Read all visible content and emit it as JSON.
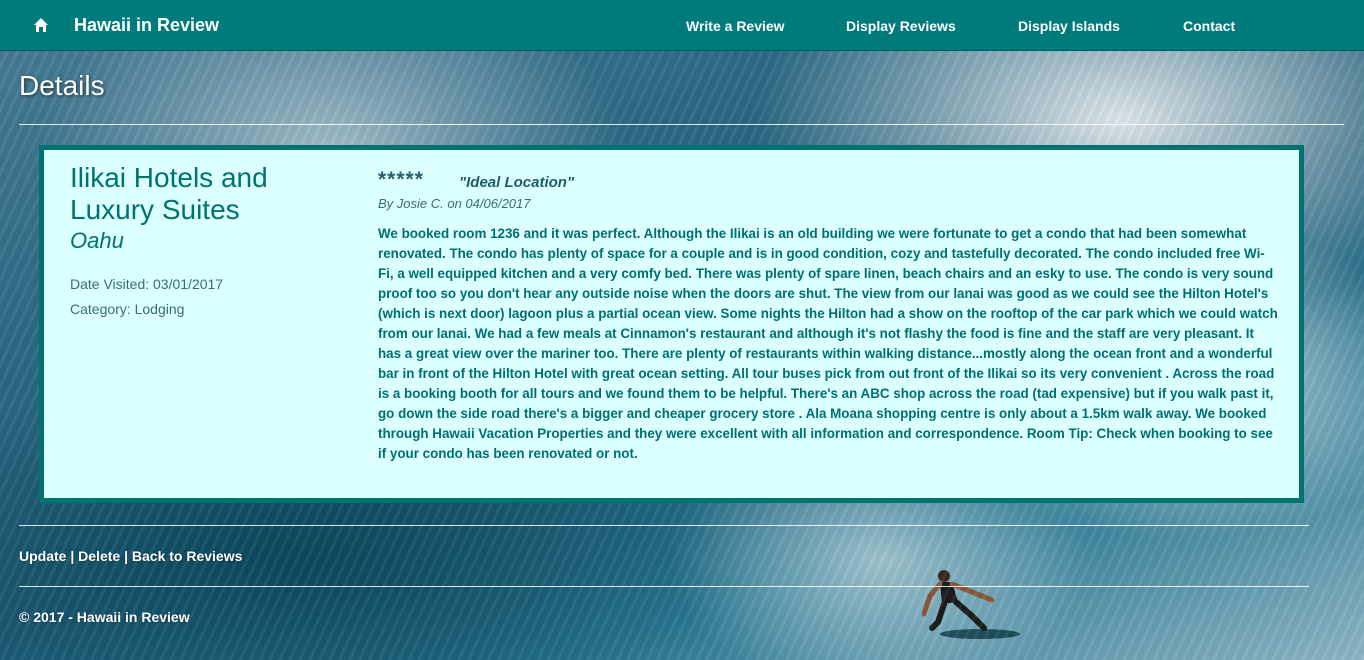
{
  "nav": {
    "home_icon": "home-icon",
    "brand": "Hawaii in Review",
    "links": [
      "Write a Review",
      "Display Reviews",
      "Display Islands",
      "Contact"
    ]
  },
  "page_title": "Details",
  "place": {
    "name": "Ilikai Hotels and Luxury Suites",
    "island": "Oahu",
    "date_visited_label": "Date Visited:",
    "date_visited": "03/01/2017",
    "category_label": "Category:",
    "category": "Lodging"
  },
  "review": {
    "rating": 5,
    "stars": "*****",
    "title": "\"Ideal Location\"",
    "byline": "By Josie C. on 04/06/2017",
    "body": "We booked room 1236 and it was perfect. Although the Ilikai is an old building we were fortunate to get a condo that had been somewhat renovated. The condo has plenty of space for a couple and is in good condition, cozy and tastefully decorated. The condo included free Wi-Fi, a well equipped kitchen and a very comfy bed. There was plenty of spare linen, beach chairs and an esky to use. The condo is very sound proof too so you don't hear any outside noise when the doors are shut. The view from our lanai was good as we could see the Hilton Hotel's (which is next door) lagoon plus a partial ocean view. Some nights the Hilton had a show on the rooftop of the car park which we could watch from our lanai. We had a few meals at Cinnamon's restaurant and although it's not flashy the food is fine and the staff are very pleasant. It has a great view over the mariner too. There are plenty of restaurants within walking distance...mostly along the ocean front and a wonderful bar in front of the Hilton Hotel with great ocean setting. All tour buses pick from out front of the Ilikai so its very convenient . Across the road is a booking booth for all tours and we found them to be helpful. There's an ABC shop across the road (tad expensive) but if you walk past it, go down the side road there's a bigger and cheaper grocery store . Ala Moana shopping centre is only about a 1.5km walk away. We booked through Hawaii Vacation Properties and they were excellent with all information and correspondence. Room Tip: Check when booking to see if your condo has been renovated or not."
  },
  "actions": {
    "update": "Update",
    "delete": "Delete",
    "back": "Back to Reviews",
    "separator": "|"
  },
  "footer": {
    "copyright": "© 2017 - Hawaii in Review"
  },
  "colors": {
    "navbar": "#007b7b",
    "card_bg": "#dcffff",
    "card_border": "#00726f",
    "accent_text": "#00706f"
  }
}
